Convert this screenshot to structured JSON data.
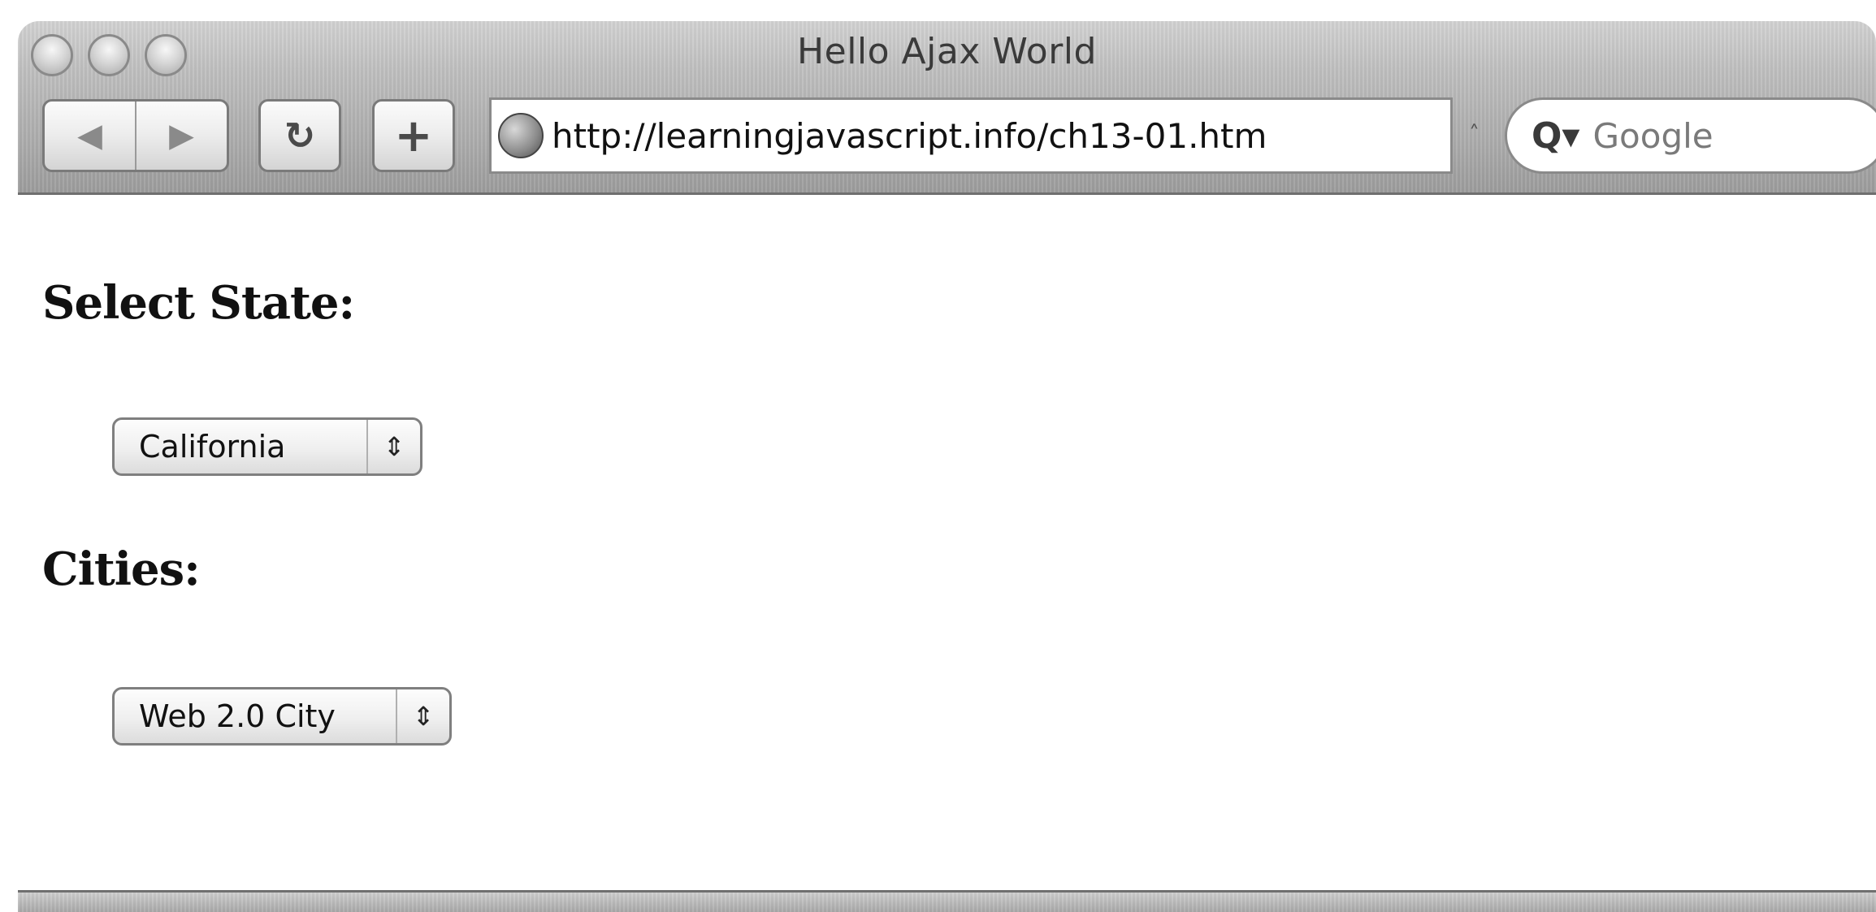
{
  "window": {
    "title": "Hello Ajax World"
  },
  "toolbar": {
    "back_icon": "◀",
    "forward_icon": "▶",
    "reload_icon": "↻",
    "add_bookmark_icon": "+",
    "address_url": "http://learningjavascript.info/ch13-01.htm",
    "snapback_icon": "˄",
    "search_icon": "Q▾",
    "search_placeholder": "Google"
  },
  "page": {
    "state_heading": "Select State:",
    "state_select_value": "California",
    "cities_heading": "Cities:",
    "cities_select_value": "Web 2.0 City",
    "select_arrows_icon": "⇕"
  },
  "icons": {
    "globe": "globe-icon",
    "search": "magnifier-icon"
  }
}
